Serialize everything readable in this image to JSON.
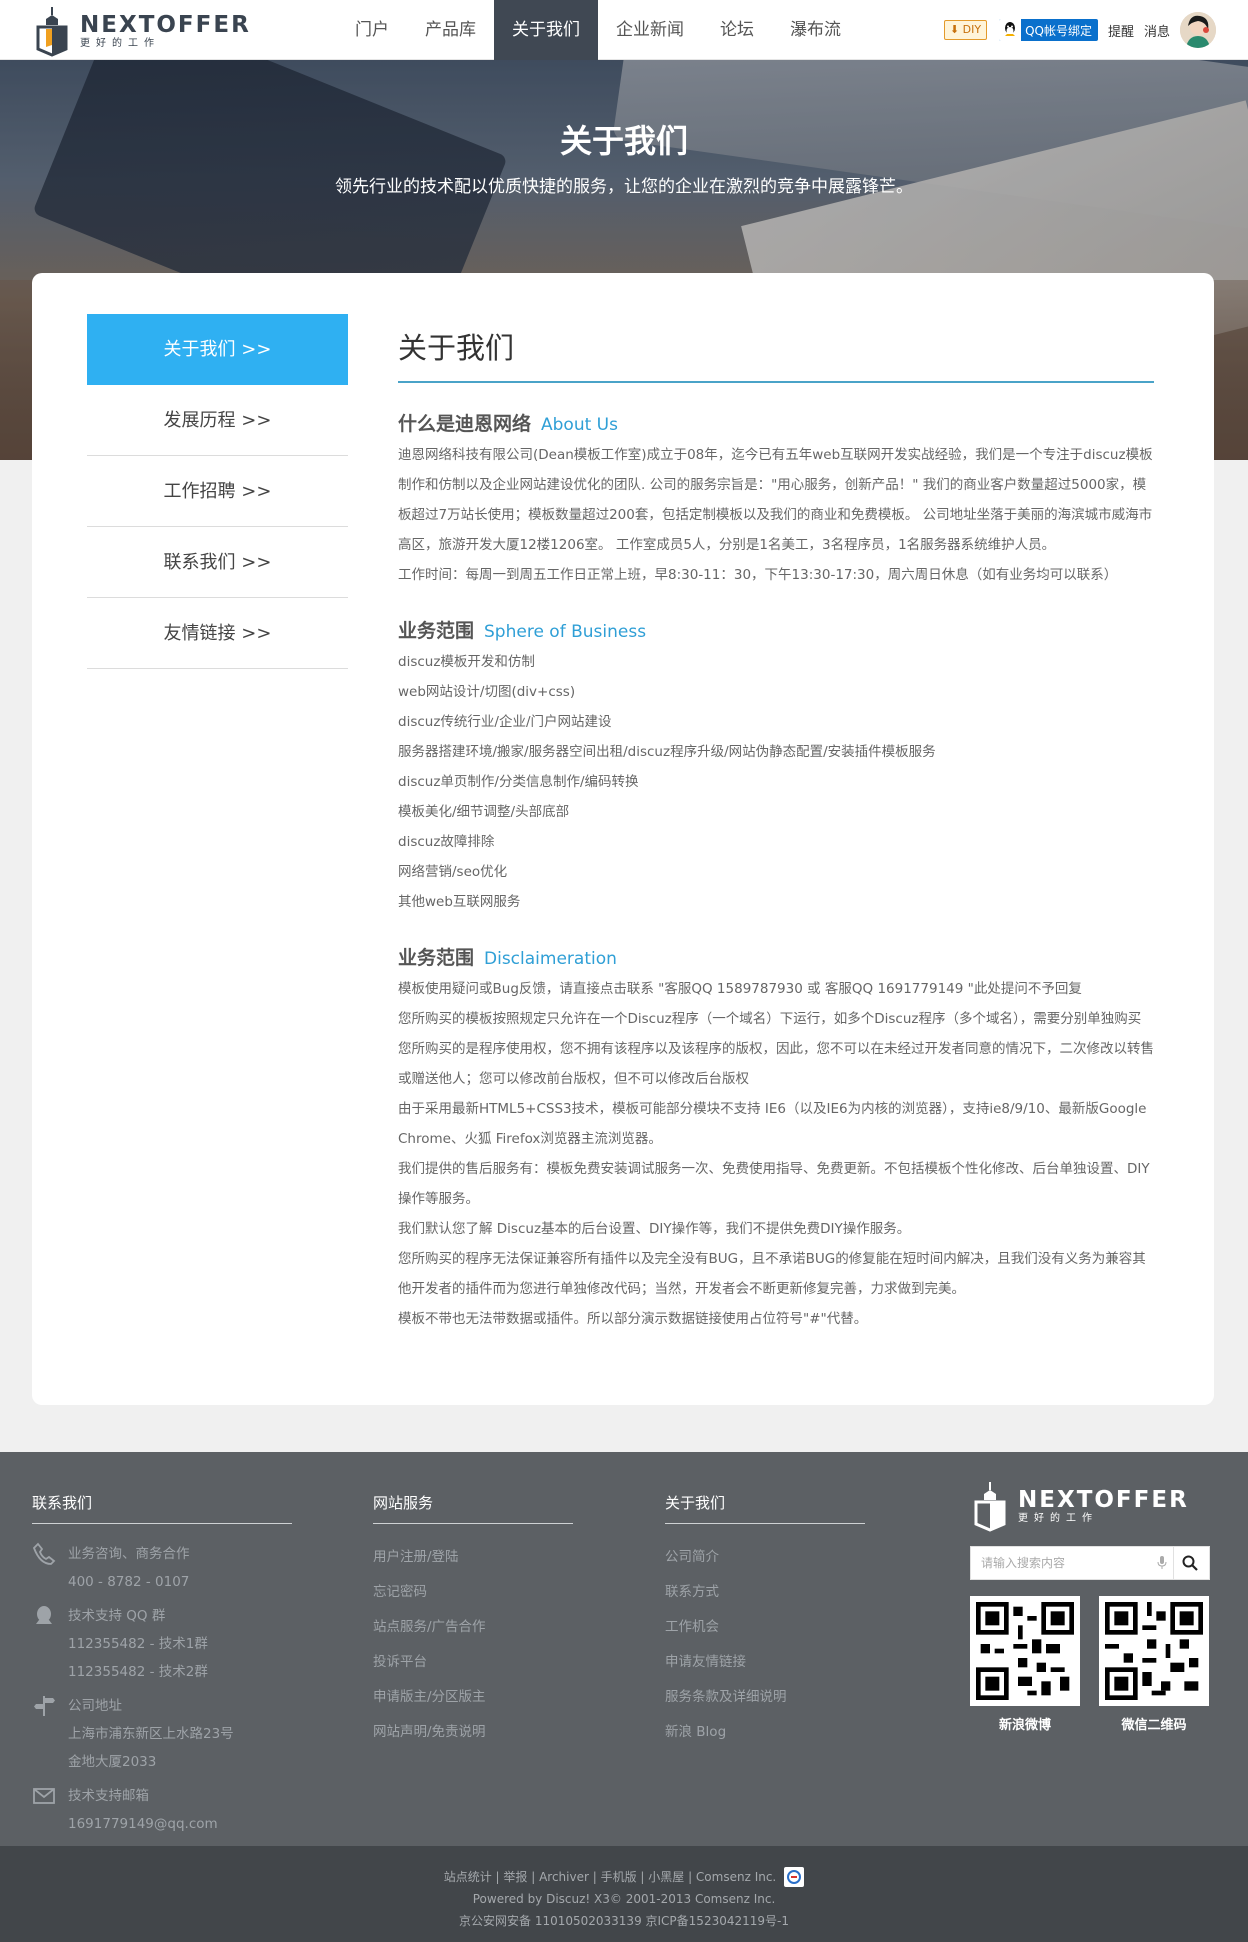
{
  "header": {
    "logo_name": "NEXTOFFER",
    "logo_slogan": "更好的工作",
    "nav": [
      {
        "label": "门户"
      },
      {
        "label": "产品库"
      },
      {
        "label": "关于我们"
      },
      {
        "label": "企业新闻"
      },
      {
        "label": "论坛"
      },
      {
        "label": "瀑布流"
      }
    ],
    "active_nav": "关于我们",
    "diy_label": "DIY",
    "qq_label": "QQ帐号绑定",
    "remind_label": "提醒",
    "message_label": "消息"
  },
  "hero": {
    "title": "关于我们",
    "subtitle": "领先行业的技术配以优质快捷的服务，让您的企业在激烈的竞争中展露锋芒。"
  },
  "sidebar": {
    "items": [
      {
        "label": "关于我们  >>"
      },
      {
        "label": "发展历程  >>"
      },
      {
        "label": "工作招聘  >>"
      },
      {
        "label": "联系我们  >>"
      },
      {
        "label": "友情链接  >>"
      }
    ],
    "accent": "#2fb0f2"
  },
  "content": {
    "title": "关于我们",
    "sections": [
      {
        "title_cn": "什么是迪恩网络",
        "title_en": "About Us",
        "paragraphs": [
          "迪恩网络科技有限公司(Dean模板工作室)成立于08年，迄今已有五年web互联网开发实战经验，我们是一个专注于discuz模板制作和仿制以及企业网站建设优化的团队. 公司的服务宗旨是：\"用心服务，创新产品！\" 我们的商业客户数量超过5000家，模板超过7万站长使用；模板数量超过200套，包括定制模板以及我们的商业和免费模板。 公司地址坐落于美丽的海滨城市威海市高区，旅游开发大厦12楼1206室。 工作室成员5人，分别是1名美工，3名程序员，1名服务器系统维护人员。",
          "工作时间：每周一到周五工作日正常上班，早8:30-11：30，下午13:30-17:30，周六周日休息（如有业务均可以联系）"
        ]
      },
      {
        "title_cn": "业务范围",
        "title_en": "Sphere of Business",
        "items": [
          "discuz模板开发和仿制",
          "web网站设计/切图(div+css)",
          "discuz传统行业/企业/门户网站建设",
          "服务器搭建环境/搬家/服务器空间出租/discuz程序升级/网站伪静态配置/安装插件模板服务",
          "discuz单页制作/分类信息制作/编码转换",
          "模板美化/细节调整/头部底部",
          "discuz故障排除",
          "网络营销/seo优化",
          "其他web互联网服务"
        ]
      },
      {
        "title_cn": "业务范围",
        "title_en": "Disclaimeration",
        "paragraphs": [
          "模板使用疑问或Bug反馈，请直接点击联系 \"客服QQ 1589787930 或 客服QQ 1691779149 \"此处提问不予回复",
          "您所购买的模板按照规定只允许在一个Discuz程序（一个域名）下运行，如多个Discuz程序（多个域名），需要分别单独购买",
          "您所购买的是程序使用权，您不拥有该程序以及该程序的版权，因此，您不可以在未经过开发者同意的情况下，二次修改以转售或赠送他人；您可以修改前台版权，但不可以修改后台版权",
          "由于采用最新HTML5+CSS3技术，模板可能部分模块不支持 IE6（以及IE6为内核的浏览器），支持ie8/9/10、最新版Google Chrome、火狐 Firefox浏览器主流浏览器。",
          "我们提供的售后服务有：模板免费安装调试服务一次、免费使用指导、免费更新。不包括模板个性化修改、后台单独设置、DIY操作等服务。",
          "我们默认您了解 Discuz基本的后台设置、DIY操作等，我们不提供免费DIY操作服务。",
          "您所购买的程序无法保证兼容所有插件以及完全没有BUG，且不承诺BUG的修复能在短时间内解决，且我们没有义务为兼容其他开发者的插件而为您进行单独修改代码；当然，开发者会不断更新修复完善，力求做到完美。",
          "模板不带也无法带数据或插件。所以部分演示数据链接使用占位符号\"#\"代替。"
        ]
      }
    ]
  },
  "footer": {
    "contact": {
      "title": "联系我们",
      "rows": [
        {
          "icon": "phone-icon",
          "lines": [
            "业务咨询、商务合作",
            "400 - 8782 - 0107"
          ]
        },
        {
          "icon": "qq-penguin-icon",
          "lines": [
            "技术支持 QQ 群",
            "112355482 - 技术1群",
            "112355482 - 技术2群"
          ]
        },
        {
          "icon": "signpost-icon",
          "lines": [
            "公司地址",
            "上海市浦东新区上水路23号",
            "金地大厦2033"
          ]
        },
        {
          "icon": "mail-icon",
          "lines": [
            "技术支持邮箱",
            "1691779149@qq.com"
          ]
        }
      ]
    },
    "services": {
      "title": "网站服务",
      "links": [
        "用户注册/登陆",
        "忘记密码",
        "站点服务/广告合作",
        "投诉平台",
        "申请版主/分区版主",
        "网站声明/免责说明"
      ]
    },
    "about": {
      "title": "关于我们",
      "links": [
        "公司简介",
        "联系方式",
        "工作机会",
        "申请友情链接",
        "服务条款及详细说明",
        "新浪 Blog"
      ]
    },
    "logo_name": "NEXTOFFER",
    "logo_slogan": "更好的工作",
    "search_placeholder": "请输入搜索内容",
    "qr_codes": [
      {
        "label": "新浪微博"
      },
      {
        "label": "微信二维码"
      }
    ]
  },
  "copyright": {
    "links_line": "站点统计 | 举报 | Archiver | 手机版 | 小黑屋 |  Comsenz Inc.",
    "powered": "Powered by Discuz! X3© 2001-2013 Comsenz Inc.",
    "icp": "京公安网安备 11010502033139 京ICP备1523042119号-1"
  }
}
